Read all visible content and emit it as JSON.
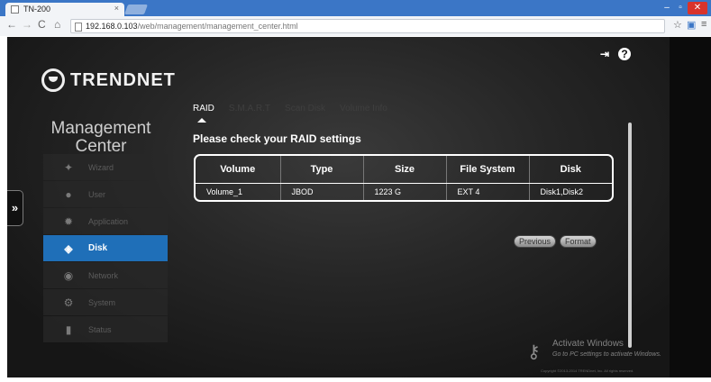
{
  "browser": {
    "tab_title": "TN-200",
    "tab_close": "×",
    "url_host": "192.168.0.103",
    "url_path": "/web/management/management_center.html",
    "window": {
      "min": "–",
      "max": "▫",
      "close": "✕"
    }
  },
  "brand": {
    "logo_text": "TRENDNET"
  },
  "header": {
    "logout_icon": "logout-icon",
    "help_icon": "?"
  },
  "sidebar": {
    "title": "Management Center",
    "items": [
      {
        "label": "Wizard",
        "icon": "wand-icon"
      },
      {
        "label": "User",
        "icon": "user-icon"
      },
      {
        "label": "Application",
        "icon": "gear-icon"
      },
      {
        "label": "Disk",
        "icon": "disk-icon",
        "active": true
      },
      {
        "label": "Network",
        "icon": "network-icon"
      },
      {
        "label": "System",
        "icon": "system-icon"
      },
      {
        "label": "Status",
        "icon": "status-icon"
      }
    ]
  },
  "toggle": {
    "label": "»"
  },
  "tabs": [
    {
      "label": "RAID",
      "active": true
    },
    {
      "label": "S.M.A.R.T"
    },
    {
      "label": "Scan Disk"
    },
    {
      "label": "Volume Info"
    }
  ],
  "main": {
    "heading": "Please check your RAID settings",
    "table": {
      "headers": [
        "Volume",
        "Type",
        "Size",
        "File System",
        "Disk"
      ],
      "rows": [
        [
          "Volume_1",
          "JBOD",
          "1223 G",
          "EXT 4",
          "Disk1,Disk2"
        ]
      ]
    },
    "buttons": {
      "previous": "Previous",
      "format": "Format"
    }
  },
  "watermark": {
    "title": "Activate Windows",
    "subtitle": "Go to PC settings to activate Windows."
  },
  "footer": {
    "copyright": "Copyright ©2013-2014 TRENDnet, Inc. All rights reserved."
  },
  "colors": {
    "accent": "#1f6fb8",
    "tab_strip": "#3b76c6"
  }
}
